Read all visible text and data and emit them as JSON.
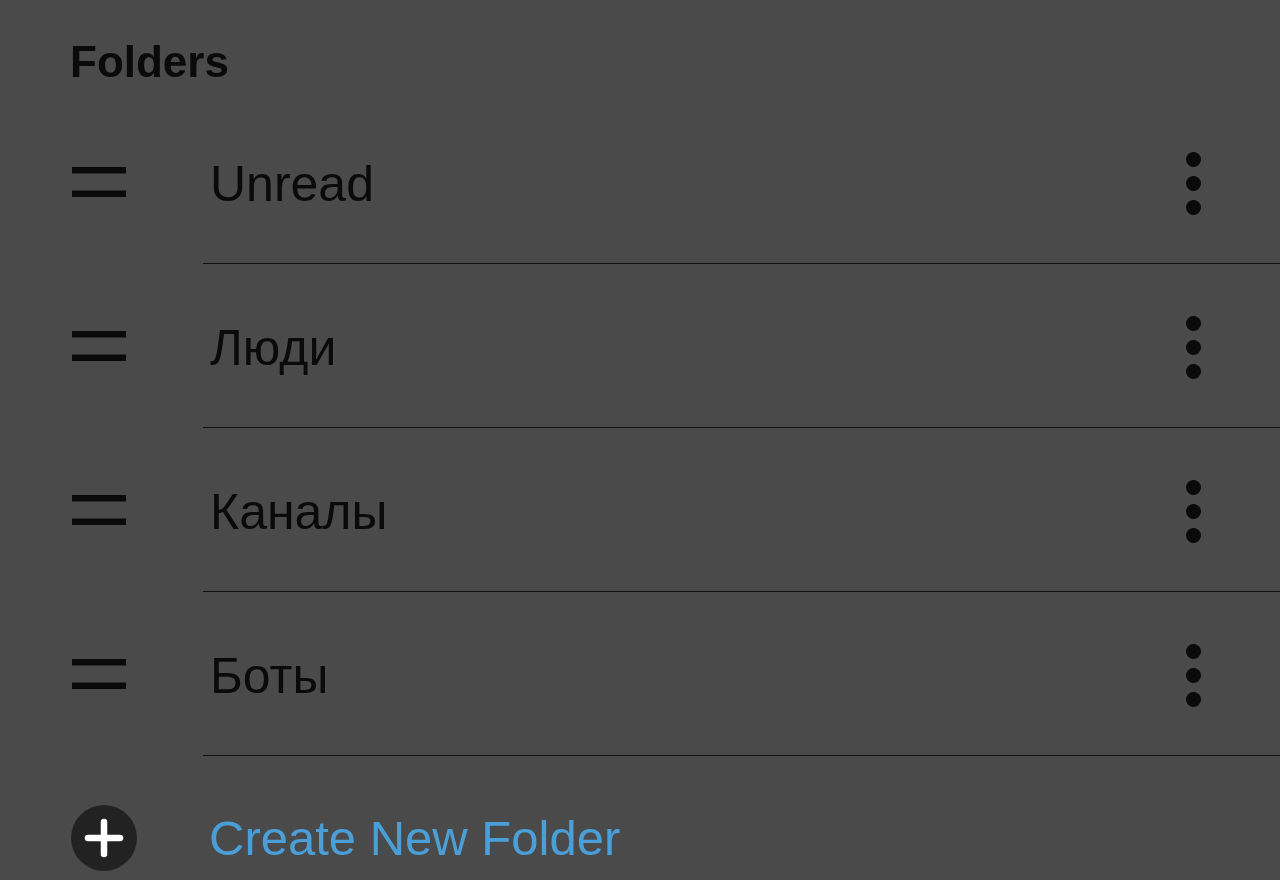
{
  "header": {
    "title": "Folders"
  },
  "folders": [
    {
      "name": "Unread"
    },
    {
      "name": "Люди"
    },
    {
      "name": "Каналы"
    },
    {
      "name": "Боты"
    }
  ],
  "create_button": {
    "label": "Create New Folder"
  }
}
